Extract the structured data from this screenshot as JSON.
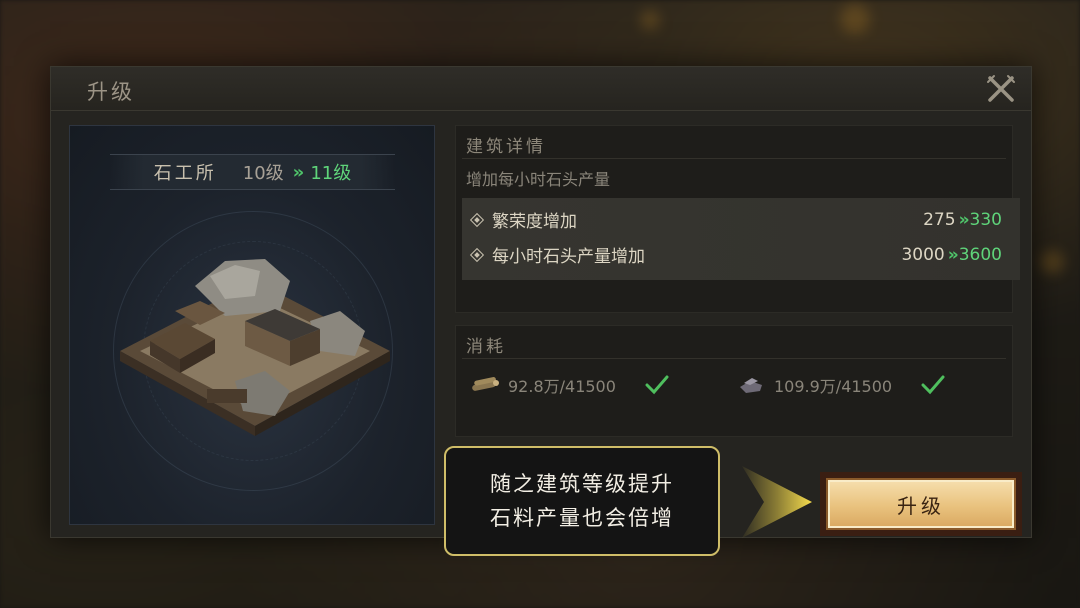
{
  "modal": {
    "title": "升级"
  },
  "building": {
    "name": "石工所",
    "level_from": "10级",
    "level_to": "11级",
    "level_arrow": "»"
  },
  "details": {
    "title": "建筑详情",
    "description": "增加每小时石头产量",
    "stats": [
      {
        "name": "繁荣度增加",
        "from": "275",
        "arrow": "»",
        "to": "330"
      },
      {
        "name": "每小时石头产量增加",
        "from": "3000",
        "arrow": "»",
        "to": "3600"
      }
    ]
  },
  "cost": {
    "title": "消耗",
    "items": [
      {
        "icon": "wood-icon",
        "amount": "92.8万/41500",
        "status": "check-icon"
      },
      {
        "icon": "stone-icon",
        "amount": "109.9万/41500",
        "status": "check-icon"
      }
    ]
  },
  "tooltip": {
    "line1": "随之建筑等级提升",
    "line2": "石料产量也会倍增"
  },
  "upgrade_button": {
    "label": "升级"
  },
  "colors": {
    "accent_green": "#5fd47a",
    "tooltip_border": "#cfbd68",
    "pointer_yellow": "#f1d64a",
    "button_gold": "#e9c27e"
  }
}
